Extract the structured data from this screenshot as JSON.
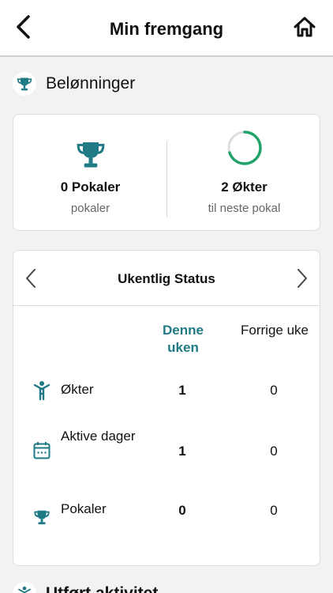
{
  "header": {
    "title": "Min fremgang"
  },
  "rewards": {
    "section_title": "Belønninger",
    "trophies_main": "0 Pokaler",
    "trophies_sub": "pokaler",
    "sessions_main": "2 Økter",
    "sessions_sub": "til neste pokal",
    "progress_fraction": 0.7
  },
  "weekly": {
    "title": "Ukentlig Status",
    "col_current": "Denne uken",
    "col_previous": "Forrige uke",
    "rows": [
      {
        "label": "Økter",
        "current": "1",
        "previous": "0",
        "icon": "person-icon"
      },
      {
        "label": "Aktive dager",
        "current": "1",
        "previous": "0",
        "icon": "calendar-icon"
      },
      {
        "label": "Pokaler",
        "current": "0",
        "previous": "0",
        "icon": "trophy-icon"
      }
    ]
  },
  "next_section": {
    "title": "Utført aktivitet"
  },
  "colors": {
    "accent": "#1f7a85",
    "progress": "#22a36a",
    "progress_track": "#dddddd"
  }
}
